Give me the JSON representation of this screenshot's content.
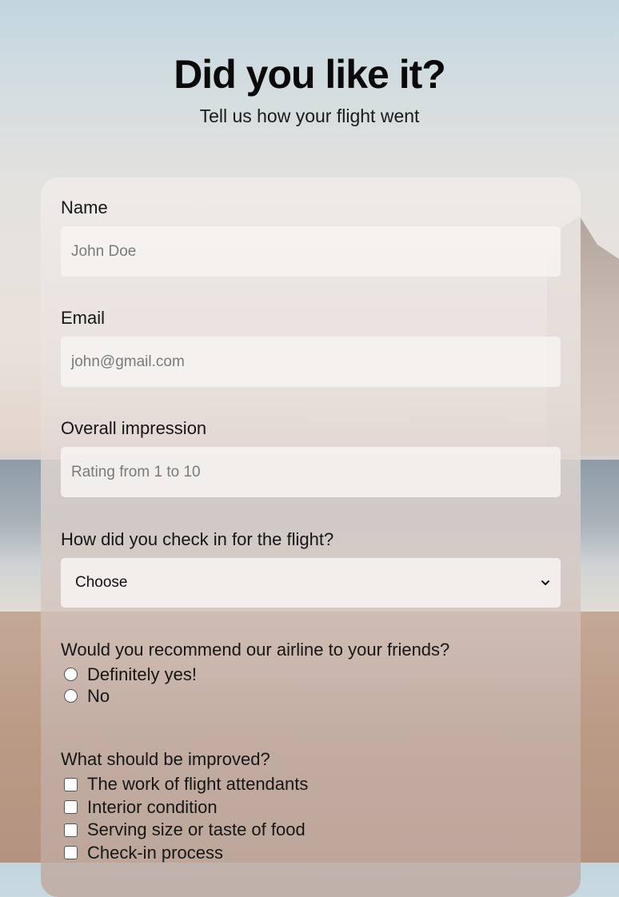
{
  "header": {
    "title": "Did you like it?",
    "subtitle": "Tell us how your flight went"
  },
  "form": {
    "name": {
      "label": "Name",
      "placeholder": "John Doe"
    },
    "email": {
      "label": "Email",
      "placeholder": "john@gmail.com"
    },
    "impression": {
      "label": "Overall impression",
      "placeholder": "Rating from 1 to 10"
    },
    "checkin": {
      "label": "How did you check in for the flight?",
      "selected": "Choose",
      "icon": "chevron-down-icon"
    },
    "recommend": {
      "label": "Would you recommend our airline to your friends?",
      "options": [
        "Definitely yes!",
        "No"
      ]
    },
    "improve": {
      "label": "What should be improved?",
      "options": [
        "The work of flight attendants",
        "Interior condition",
        "Serving size or taste of food",
        "Check-in process"
      ]
    }
  }
}
